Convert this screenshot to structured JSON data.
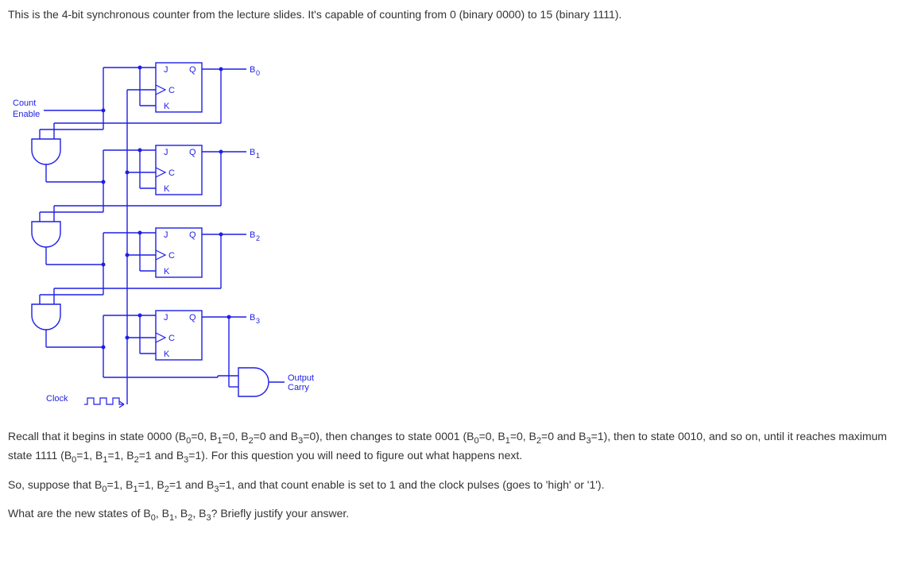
{
  "intro": "This is the 4-bit synchronous counter from the lecture slides.  It's capable of counting from 0 (binary 0000) to 15 (binary 1111).",
  "diagram": {
    "count_label_1": "Count",
    "count_label_2": "Enable",
    "clock_label": "Clock",
    "out_label_1": "Output",
    "out_label_2": "Carry",
    "flipflops": [
      {
        "j": "J",
        "k": "K",
        "c": "C",
        "q": "Q",
        "out": "B",
        "sub": "0"
      },
      {
        "j": "J",
        "k": "K",
        "c": "C",
        "q": "Q",
        "out": "B",
        "sub": "1"
      },
      {
        "j": "J",
        "k": "K",
        "c": "C",
        "q": "Q",
        "out": "B",
        "sub": "2"
      },
      {
        "j": "J",
        "k": "K",
        "c": "C",
        "q": "Q",
        "out": "B",
        "sub": "3"
      }
    ]
  },
  "para1_parts": [
    "Recall that it begins in state 0000 (B",
    "0",
    "=0, B",
    "1",
    "=0, B",
    "2",
    "=0 and B",
    "3",
    "=0), then changes to state 0001 (B",
    "0",
    "=0, B",
    "1",
    "=0, B",
    "2",
    "=0 and B",
    "3",
    "=1), then to state 0010, and so on, until it reaches maximum state 1111 (B",
    "0",
    "=1, B",
    "1",
    "=1, B",
    "2",
    "=1 and B",
    "3",
    "=1).  For this question you will need to figure out what happens next."
  ],
  "para2_parts": [
    "So, suppose that B",
    "0",
    "=1, B",
    "1",
    "=1, B",
    "2",
    "=1 and B",
    "3",
    "=1, and that count enable is set to 1 and the clock pulses (goes to 'high' or '1')."
  ],
  "para3_parts": [
    "What are the new states of B",
    "0",
    ", B",
    "1",
    ", B",
    "2",
    ", B",
    "3",
    "? Briefly justify your answer."
  ]
}
